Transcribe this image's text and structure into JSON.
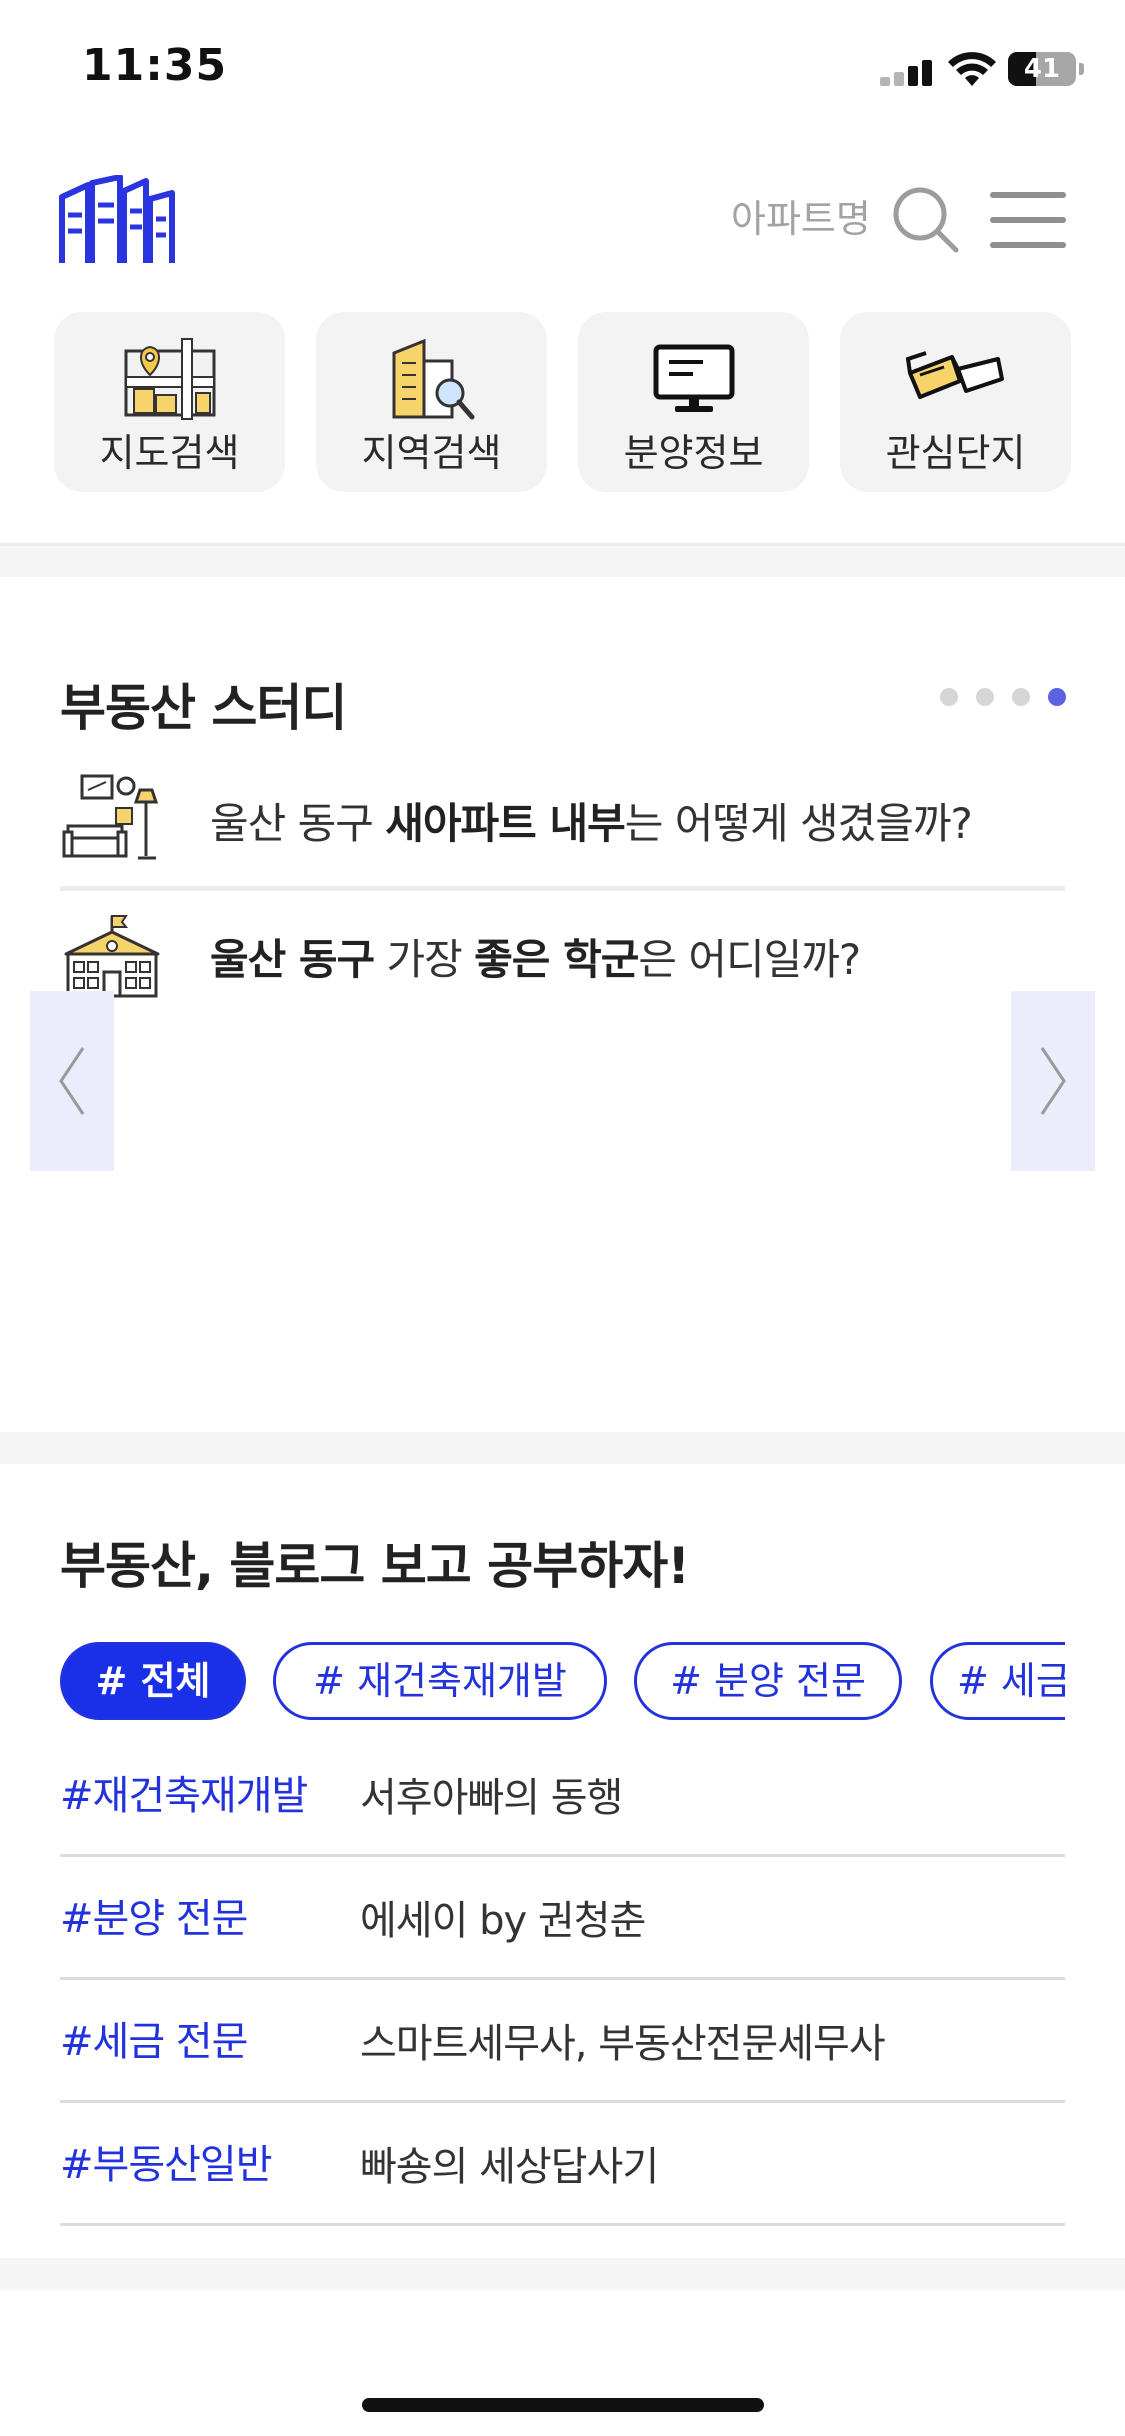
{
  "status_bar": {
    "time": "11:35",
    "battery_level": "41",
    "battery_fraction": 0.41
  },
  "header": {
    "search_label": "아파트명",
    "logo_icon": "building-logo-icon",
    "search_icon": "search-icon",
    "menu_icon": "hamburger-menu-icon"
  },
  "quick_menu": [
    {
      "label": "지도검색",
      "icon": "map-pin-icon"
    },
    {
      "label": "지역검색",
      "icon": "building-search-icon"
    },
    {
      "label": "분양정보",
      "icon": "monitor-icon"
    },
    {
      "label": "관심단지",
      "icon": "3d-glasses-icon"
    }
  ],
  "study": {
    "title": "부동산 스터디",
    "page_count": 4,
    "active_page": 4,
    "items": [
      {
        "pre": "울산 동구 ",
        "bold1": "새아파트 내부",
        "post": "는 어떻게 생겼을까?",
        "icon": "living-room-icon"
      },
      {
        "pre1": "울산 동구",
        "mid": " 가장 ",
        "bold": "좋은 학군",
        "post": "은 어디일까?",
        "icon": "school-icon"
      }
    ],
    "prev_icon": "chevron-left-icon",
    "next_icon": "chevron-right-icon"
  },
  "blog": {
    "title": "부동산, 블로그 보고 공부하자!",
    "tags": [
      "# 전체",
      "# 재건축재개발",
      "# 분양 전문",
      "# 세금"
    ],
    "active_tag": 0,
    "rows": [
      {
        "tag": "#재건축재개발",
        "name": "서후아빠의 동행"
      },
      {
        "tag": "#분양 전문",
        "name": "에세이 by 권청춘"
      },
      {
        "tag": "#세금 전문",
        "name": "스마트세무사, 부동산전문세무사"
      },
      {
        "tag": "#부동산일반",
        "name": "빠숑의 세상답사기"
      }
    ]
  },
  "colors": {
    "accent": "#1a2fe8",
    "dot_active": "#5a63e6",
    "arrow_bg": "#ececfc"
  }
}
